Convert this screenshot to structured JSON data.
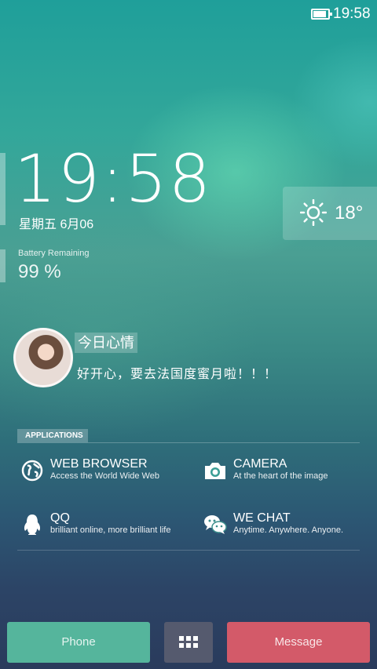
{
  "status_bar": {
    "time": "19:58",
    "battery_icon": "battery-full-icon"
  },
  "clock": {
    "time": "19:58",
    "date": "星期五  6月06"
  },
  "battery": {
    "label": "Battery Remaining",
    "value": "99 %"
  },
  "weather": {
    "icon": "sun-icon",
    "temperature": "18°"
  },
  "mood": {
    "title": "今日心情",
    "text": "好开心，要去法国度蜜月啦！！！",
    "avatar": "avatar-photo"
  },
  "applications": {
    "header": "APPLICATIONS",
    "items": [
      {
        "name": "WEB BROWSER",
        "description": "Access the World Wide Web",
        "icon": "globe-icon"
      },
      {
        "name": "CAMERA",
        "description": "At the heart of the image",
        "icon": "camera-icon"
      },
      {
        "name": "QQ",
        "description": "brilliant online, more brilliant life",
        "icon": "penguin-icon"
      },
      {
        "name": "WE CHAT",
        "description": "Anytime. Anywhere. Anyone.",
        "icon": "chat-bubbles-icon"
      }
    ]
  },
  "dock": {
    "phone_label": "Phone",
    "menu_icon": "grid-menu-icon",
    "message_label": "Message"
  },
  "colors": {
    "phone": "#55b59c",
    "menu": "#555a6e",
    "message": "#d35a69"
  }
}
